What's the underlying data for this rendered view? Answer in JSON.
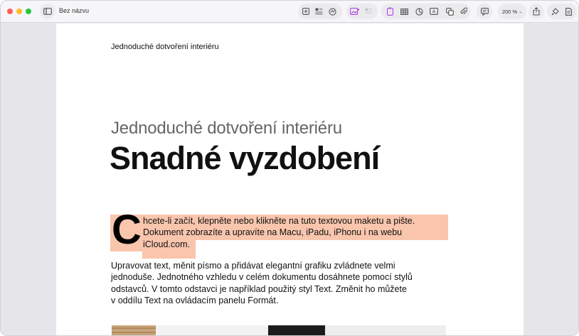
{
  "window": {
    "title": "Bez názvu"
  },
  "toolbar": {
    "zoom_label": "200 %"
  },
  "document": {
    "header": "Jednoduché dotvoření interiéru",
    "subtitle": "Jednoduché dotvoření interiéru",
    "title": "Snadné vyzdobení",
    "drop_cap": "C",
    "para1_lines": [
      "hcete-li začít, klepněte nebo klikněte na tuto textovou maketu a pište.",
      "Dokument zobrazíte a upravíte na Macu, iPadu, iPhonu i na webu",
      "iCloud.com."
    ],
    "para2_lines": [
      "Upravovat text, měnit písmo a přidávat elegantní grafiku zvládnete velmi",
      "jednoduše. Jednotného vzhledu v celém dokumentu dosáhnete pomocí stylů",
      "odstavců. V tomto odstavci je například použitý styl Text. Změnit ho můžete",
      "v oddílu Text na ovládacím panelu Formát."
    ]
  },
  "colors": {
    "selection": "#f9c5ad",
    "accent": "#b344e8"
  }
}
